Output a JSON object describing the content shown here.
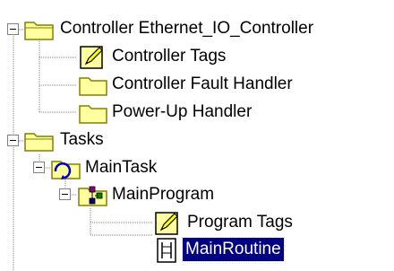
{
  "tree": {
    "nodes": [
      {
        "id": "controller",
        "label": "Controller Ethernet_IO_Controller",
        "icon": "folder-icon",
        "expanded": true
      },
      {
        "id": "controller-tags",
        "label": "Controller Tags",
        "icon": "tags-icon"
      },
      {
        "id": "fault-handler",
        "label": "Controller Fault Handler",
        "icon": "folder-icon"
      },
      {
        "id": "powerup-handler",
        "label": "Power-Up Handler",
        "icon": "folder-icon"
      },
      {
        "id": "tasks",
        "label": "Tasks",
        "icon": "folder-icon",
        "expanded": true
      },
      {
        "id": "maintask",
        "label": "MainTask",
        "icon": "task-icon",
        "expanded": true
      },
      {
        "id": "mainprogram",
        "label": "MainProgram",
        "icon": "program-icon",
        "expanded": true
      },
      {
        "id": "program-tags",
        "label": "Program Tags",
        "icon": "tags-icon"
      },
      {
        "id": "mainroutine",
        "label": "MainRoutine",
        "icon": "routine-icon",
        "selected": true
      }
    ],
    "expander_glyph": "−"
  },
  "colors": {
    "folder": "#ffffa0",
    "folder_outline": "#808000",
    "selection_bg": "#000080",
    "selection_text": "#ffffff",
    "tree_lines": "#808080"
  }
}
